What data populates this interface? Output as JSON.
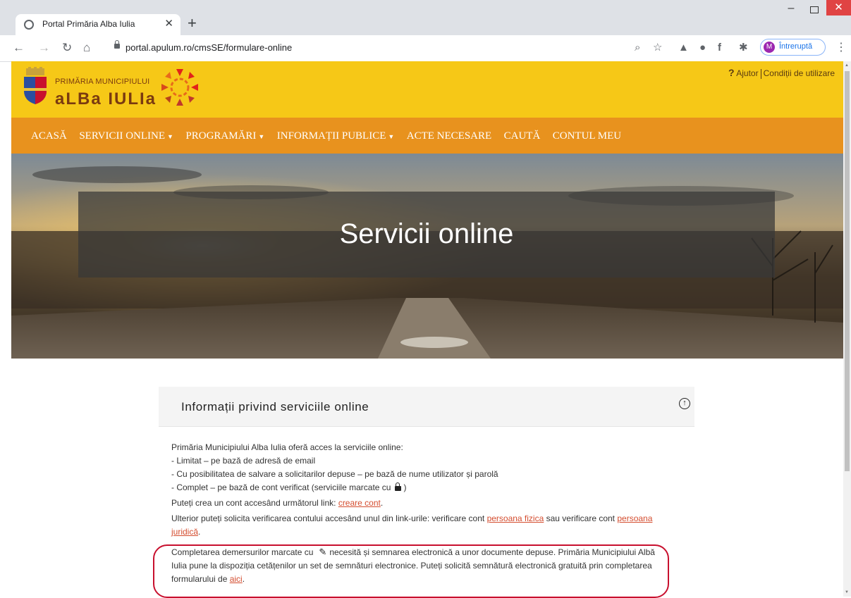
{
  "browser": {
    "tab_title": "Portal Primăria Alba Iulia",
    "url": "portal.apulum.ro/cmsSE/formulare-online",
    "profile_initial": "M",
    "profile_label": "Întreruptă"
  },
  "header": {
    "logo_top": "PRIMĂRIA MUNICIPIULUI",
    "logo_main": "aLBa IULIa",
    "help": "Ajutor",
    "terms": "Condiții de utilizare"
  },
  "nav": {
    "home": "ACASĂ",
    "services": "SERVICII ONLINE",
    "appointments": "PROGRAMĂRI",
    "public_info": "INFORMAȚII PUBLICE",
    "documents": "ACTE NECESARE",
    "search": "CAUTĂ",
    "account": "CONTUL MEU"
  },
  "hero": {
    "title": "Servicii online"
  },
  "card": {
    "title": "Informații privind serviciile online",
    "intro": "Primăria Municipiului Alba Iulia oferă acces la serviciile online:",
    "item1": "- Limitat – pe bază de adresă de email",
    "item2": "- Cu posibilitatea de salvare a solicitarilor depuse – pe bază de nume utilizator și parolă",
    "item3_pre": "- Complet – pe bază de cont verificat (serviciile marcate cu",
    "item3_post": ")",
    "create_pre": "Puteți crea un cont accesând următorul link:",
    "create_link": "creare cont",
    "create_post": ".",
    "verify_pre": "Ulterior puteți solicita verificarea contului accesând unul din link-urile: verificare cont",
    "verify_link1": "persoana fizica",
    "verify_mid": "sau verificare cont",
    "verify_link2": "persoana juridică",
    "verify_post": ".",
    "sign_pre": "Completarea demersurilor marcate cu",
    "sign_text": "necesită și semnarea electronică a unor documente depuse. Primăria Municipiului Albă Iulia pune la dispoziția cetățenilor un set de semnături electronice. Puteți solicită semnătură electronică gratuită prin completarea formularului de",
    "sign_link": "aici",
    "sign_post": "."
  }
}
